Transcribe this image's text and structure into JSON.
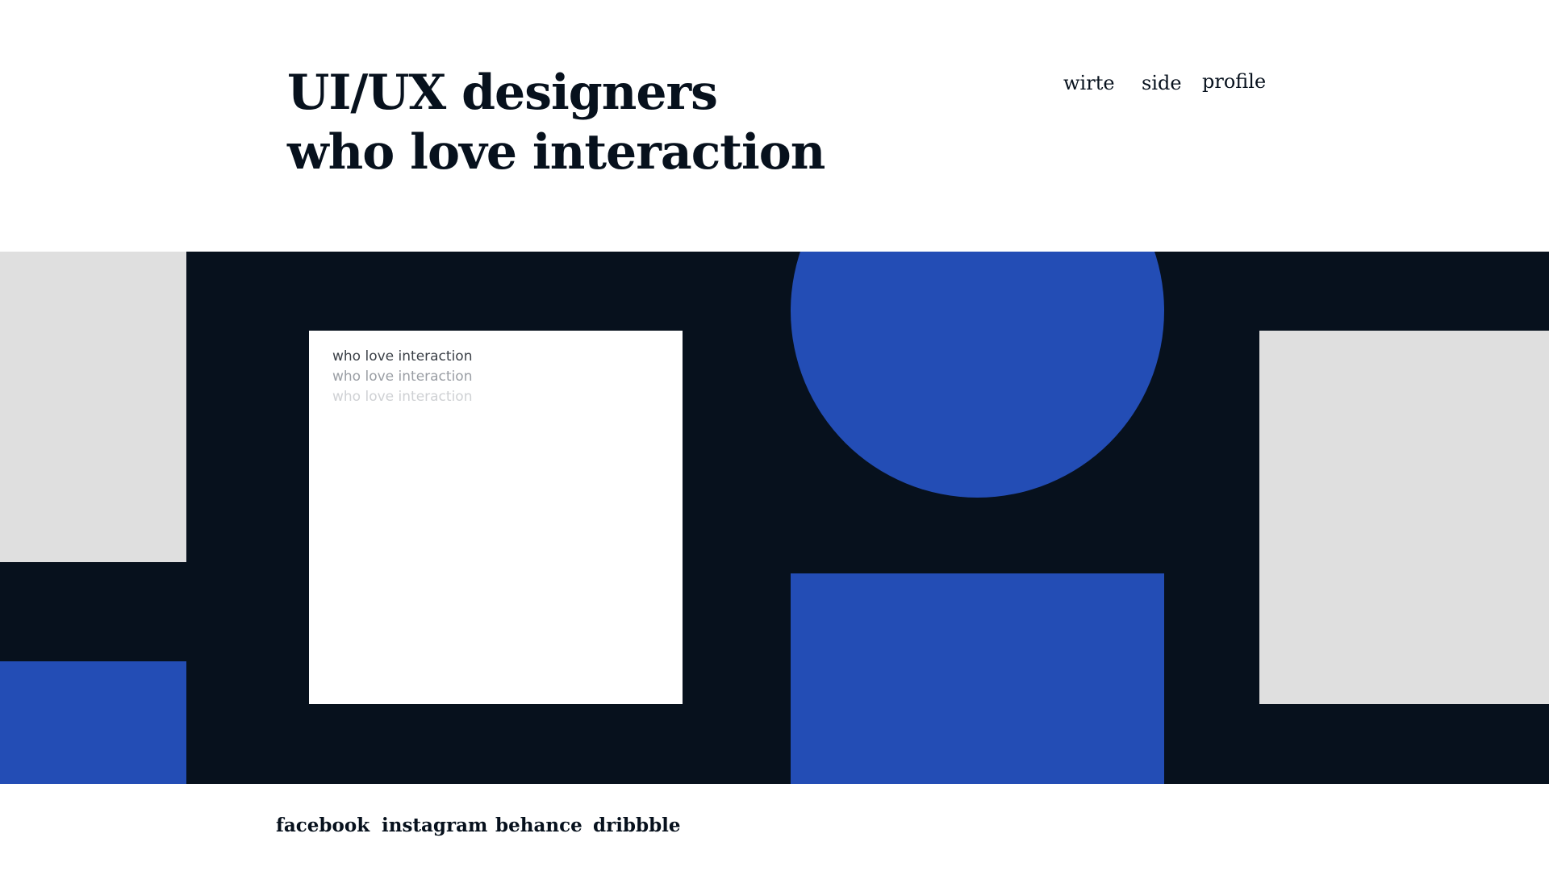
{
  "header": {
    "title_line1": "UI/UX designers",
    "title_line2": "who love interaction"
  },
  "nav": {
    "items": [
      {
        "label": "wirte"
      },
      {
        "label": "side"
      },
      {
        "label": "profile"
      }
    ]
  },
  "card": {
    "lines": [
      "who love interaction",
      "who love interaction",
      "who love interaction"
    ]
  },
  "footer": {
    "links": [
      {
        "label": "facebook"
      },
      {
        "label": "instagram"
      },
      {
        "label": "behance"
      },
      {
        "label": "dribbble"
      }
    ]
  },
  "colors": {
    "dark": "#07111d",
    "blue": "#234db5",
    "gray": "#dfdfdf",
    "white": "#ffffff"
  }
}
